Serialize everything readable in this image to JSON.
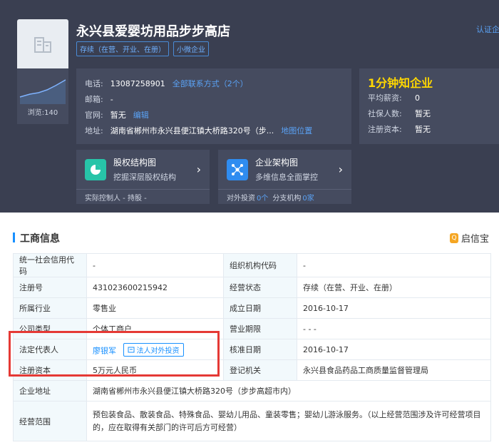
{
  "company": {
    "name": "永兴县爱婴坊用品步步高店",
    "tags": [
      "存续（在营、开业、在册）",
      "小微企业"
    ],
    "certify": "认证企业"
  },
  "views": "浏览:140",
  "contact": {
    "phone_label": "电话:",
    "phone": "13087258901",
    "phone_link": "全部联系方式（2个）",
    "email_label": "邮箱:",
    "email": "-",
    "website_label": "官网:",
    "website": "暂无",
    "website_link": "编辑",
    "address_label": "地址:",
    "address": "湖南省郴州市永兴县便江镇大桥路320号（步...",
    "address_link": "地图位置"
  },
  "minute": {
    "title": "1分钟知企业",
    "rows": [
      {
        "label": "平均薪资:",
        "value": "0"
      },
      {
        "label": "社保人数:",
        "value": "暂无"
      },
      {
        "label": "注册资本:",
        "value": "暂无"
      }
    ]
  },
  "equity_card": {
    "title": "股权结构图",
    "desc": "挖掘深层股权结构",
    "bottom": "实际控制人 -  持股 -"
  },
  "org_card": {
    "title": "企业架构图",
    "desc": "多维信息全面掌控",
    "invest_label": "对外投资",
    "invest_num": "0个",
    "branch_label": "分支机构",
    "branch_num": "0家"
  },
  "section": {
    "title": "工商信息",
    "brand": "启信宝"
  },
  "table": {
    "credit_code_label": "统一社会信用代码",
    "credit_code": "-",
    "org_code_label": "组织机构代码",
    "org_code": "-",
    "reg_no_label": "注册号",
    "reg_no": "431023600215942",
    "status_label": "经营状态",
    "status": "存续（在营、开业、在册）",
    "industry_label": "所属行业",
    "industry": "零售业",
    "founded_label": "成立日期",
    "founded": "2016-10-17",
    "type_label": "公司类型",
    "type": "个体工商户",
    "term_label": "营业期限",
    "term": "- - -",
    "rep_label": "法定代表人",
    "rep": "廖银军",
    "rep_button": "法人对外投资",
    "approve_label": "核准日期",
    "approve": "2016-10-17",
    "capital_label": "注册资本",
    "capital": "5万元人民币",
    "authority_label": "登记机关",
    "authority": "永兴县食品药品工商质量监督管理局",
    "address_label": "企业地址",
    "address": "湖南省郴州市永兴县便江镇大桥路320号（步步高超市内）",
    "scope_label": "经营范围",
    "scope": "预包装食品、散装食品、特殊食品、婴幼儿用品、童装零售；婴幼儿游泳服务。（以上经营范围涉及许可经营项目的，应在取得有关部门的许可后方可经营）"
  },
  "colors": {
    "accent": "#1890ff",
    "highlight": "#e53935",
    "header_bg": "#3a3f51"
  }
}
